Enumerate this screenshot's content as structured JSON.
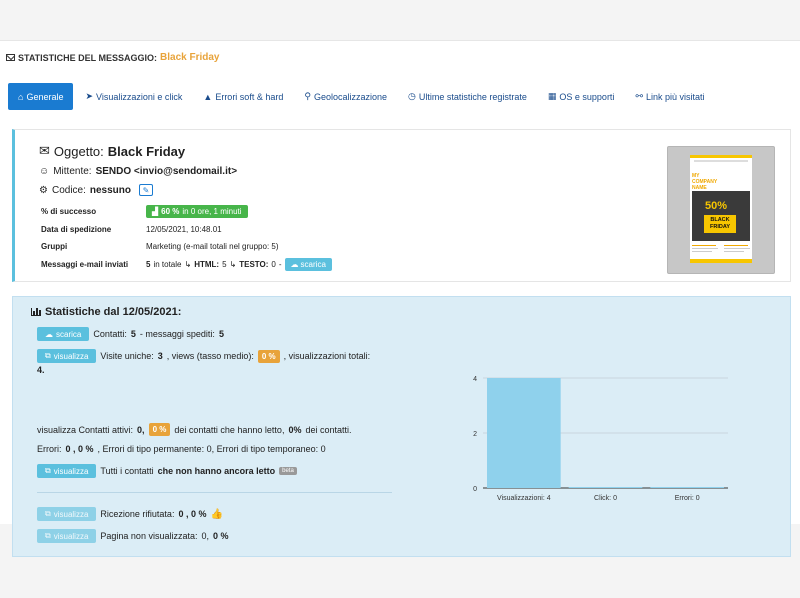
{
  "header": {
    "title_prefix": "STATISTICHE DEL MESSAGGIO:",
    "title_name": "Black Friday"
  },
  "tabs": [
    {
      "label": "Generale",
      "icon": "home-icon",
      "active": true
    },
    {
      "label": "Visualizzazioni e click",
      "icon": "cursor-icon"
    },
    {
      "label": "Errori soft & hard",
      "icon": "warning-icon"
    },
    {
      "label": "Geolocalizzazione",
      "icon": "map-marker-icon"
    },
    {
      "label": "Ultime statistiche registrate",
      "icon": "clock-icon"
    },
    {
      "label": "OS e supporti",
      "icon": "windows-icon"
    },
    {
      "label": "Link più visitati",
      "icon": "link-icon"
    }
  ],
  "message": {
    "subject_label": "Oggetto:",
    "subject": "Black Friday",
    "sender_label": "Mittente:",
    "sender": "SENDO <invio@sendomail.it>",
    "code_label": "Codice:",
    "code": "nessuno",
    "rows": {
      "success_label": "% di successo",
      "success_badge": "60 %",
      "success_text": "in 0 ore, 1 minuti",
      "date_label": "Data di spedizione",
      "date": "12/05/2021, 10:48.01",
      "groups_label": "Gruppi",
      "groups": "Marketing (e-mail totali nel gruppo: 5)",
      "sent_label": "Messaggi e-mail inviati",
      "sent_total": "5",
      "sent_total_text": "in totale",
      "html_label": "HTML:",
      "html_value": "5",
      "text_label": "TESTO:",
      "text_value": "0",
      "download": "scarica"
    },
    "preview": {
      "company": "MY COMPANY NAME",
      "pct": "50%",
      "tag": "BLACK FRIDAY"
    }
  },
  "stats": {
    "title": "Statistiche dal 12/05/2021:",
    "download_btn": "scarica",
    "contacts_label": "Contatti:",
    "contacts": "5",
    "sent_label": "- messaggi spediti:",
    "sent": "5",
    "view_btn": "visualizza",
    "unique_label": "Visite uniche:",
    "unique": "3",
    "views_label": ", views (tasso medio):",
    "views_pct": "0 %",
    "total_label": ", visualizzazioni totali:",
    "total": "4.",
    "active_prefix": "visualizza Contatti attivi:",
    "active": "0,",
    "active_pct": "0 %",
    "active_mid": "dei contatti che hanno letto,",
    "active_pct2": "0%",
    "active_suffix": "dei contatti.",
    "errors_label": "Errori:",
    "errors_value": "0 , 0 %",
    "errors_rest": ", Errori di tipo permanente: 0, Errori di tipo temporaneo: 0",
    "unread_prefix": "Tutti i contatti",
    "unread_bold": "che non hanno ancora letto",
    "beta": "beta",
    "refused_label": "Ricezione rifiutata:",
    "refused_value": "0 , 0 %",
    "notviewed_label": "Pagina non visualizzata:",
    "notviewed_a": "0,",
    "notviewed_b": "0 %"
  },
  "chart_data": {
    "type": "bar",
    "categories": [
      "Visualizzazioni: 4",
      "Click: 0",
      "Errori: 0"
    ],
    "values": [
      4,
      0,
      0
    ],
    "ylim": [
      0,
      4
    ],
    "yticks": [
      0,
      2,
      4
    ],
    "grid": true,
    "bar_color": "#8fd1ec"
  }
}
